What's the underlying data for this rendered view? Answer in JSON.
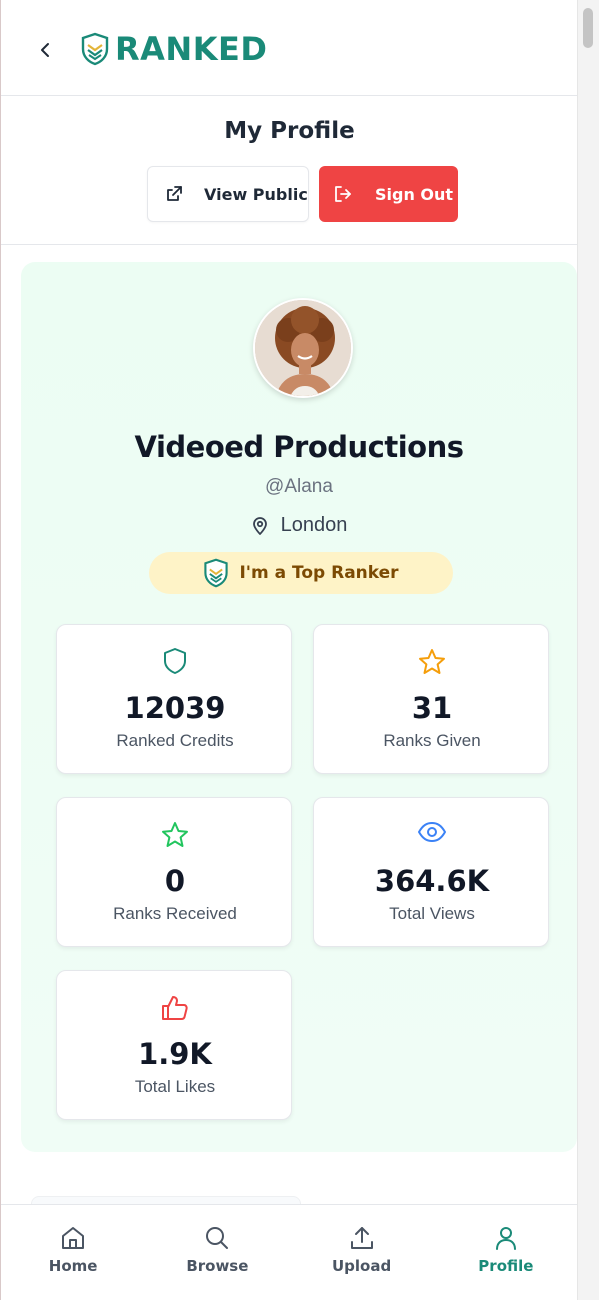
{
  "app": {
    "brand": "RANKED",
    "brand_color": "#1a8a78"
  },
  "header": {
    "back_icon": "chevron-left-icon"
  },
  "profile_header": {
    "title": "My Profile",
    "view_public_label": "View Public",
    "sign_out_label": "Sign Out"
  },
  "profile": {
    "name": "Videoed Productions",
    "handle": "@Alana",
    "location": "London",
    "badge": "I'm a Top Ranker"
  },
  "stats": [
    {
      "value": "12039",
      "label": "Ranked Credits",
      "icon": "shield-icon",
      "color": "#1a8a78"
    },
    {
      "value": "31",
      "label": "Ranks Given",
      "icon": "star-icon",
      "color": "#f59e0b"
    },
    {
      "value": "0",
      "label": "Ranks Received",
      "icon": "star-icon",
      "color": "#22c55e"
    },
    {
      "value": "364.6K",
      "label": "Total Views",
      "icon": "eye-icon",
      "color": "#3b82f6"
    },
    {
      "value": "1.9K",
      "label": "Total Likes",
      "icon": "thumbs-up-icon",
      "color": "#ef4444"
    }
  ],
  "nav": {
    "items": [
      {
        "label": "Home",
        "icon": "home-icon"
      },
      {
        "label": "Browse",
        "icon": "search-icon"
      },
      {
        "label": "Upload",
        "icon": "upload-icon"
      },
      {
        "label": "Profile",
        "icon": "user-icon",
        "active": true
      }
    ]
  }
}
